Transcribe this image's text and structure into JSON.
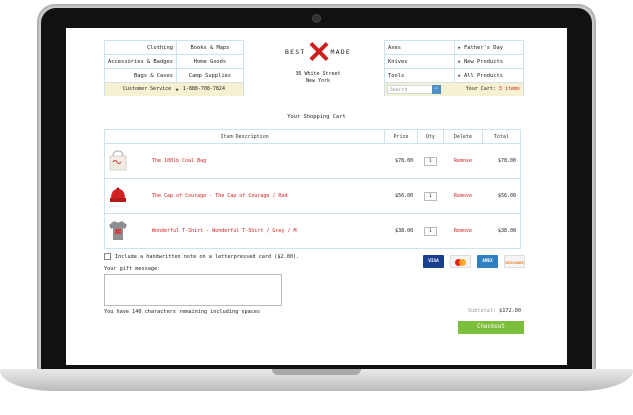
{
  "nav": {
    "left_items": [
      "Clothing",
      "Books & Maps",
      "Accessories & Badges",
      "Home Goods",
      "Bags & Cases",
      "Camp Supplies"
    ],
    "right_items": [
      "Axes",
      "Father's Day",
      "Knives",
      "New Products",
      "Tools",
      "All Products"
    ],
    "customer_service_label": "Customer Service",
    "phone": "1-888-708-7824",
    "search_placeholder": "Search",
    "cart_label": "Your Cart:",
    "cart_count": "3 items"
  },
  "brand": {
    "word_left": "BEST",
    "word_right": "MADE",
    "address_line1": "36 White Street",
    "address_line2": "New York"
  },
  "cart": {
    "title": "Your Shopping Cart",
    "headers": [
      "Item Description",
      "Price",
      "Qty",
      "Delete",
      "Total"
    ],
    "rows": [
      {
        "name": "The 100lb Coal Bag",
        "price": "$78.00",
        "qty": "1",
        "remove": "Remove",
        "total": "$78.00",
        "icon": "tote-bag-icon"
      },
      {
        "name": "The Cap of Courage - The Cap of Courage / Red",
        "price": "$56.00",
        "qty": "1",
        "remove": "Remove",
        "total": "$56.00",
        "icon": "red-cap-icon"
      },
      {
        "name": "Wonderful T-Shirt - Wonderful T-Shirt / Grey / M",
        "price": "$38.00",
        "qty": "1",
        "remove": "Remove",
        "total": "$38.00",
        "icon": "tshirt-icon"
      }
    ]
  },
  "gift": {
    "note_option": "Include a handwritten note on a letterpressed card ($2.00).",
    "message_label": "Your gift message:",
    "remaining_text": "You have 140 characters remaining including spaces"
  },
  "payment": {
    "cards": [
      "VISA",
      "MasterCard",
      "AMEX",
      "DISCOVER"
    ]
  },
  "summary": {
    "subtotal_label": "Subtotal:",
    "subtotal_value": "$172.00",
    "checkout_label": "Checkout"
  },
  "colors": {
    "accent_red": "#cc1f1f",
    "checkout_green": "#7cbf3a",
    "service_bar": "#f7f1d3"
  }
}
